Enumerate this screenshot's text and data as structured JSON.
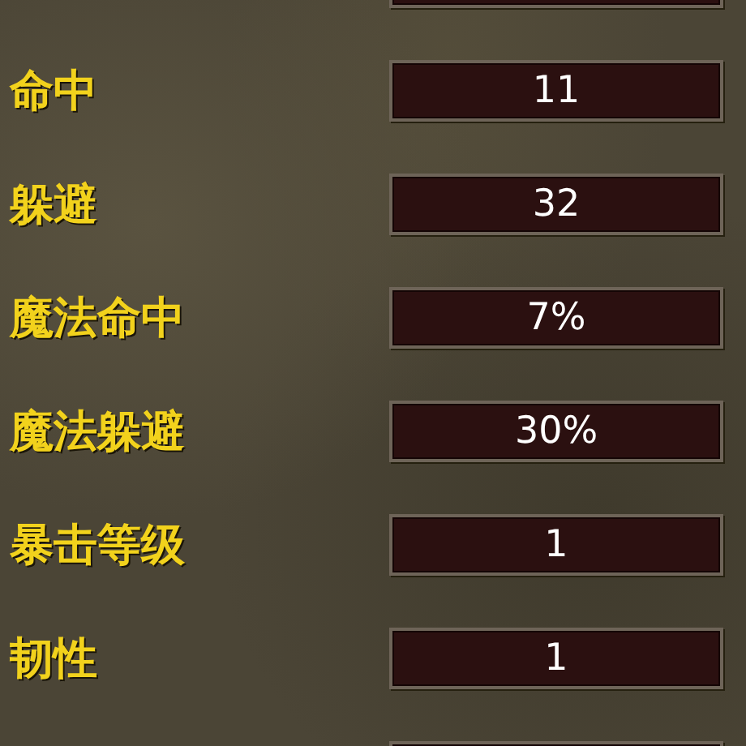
{
  "stats": [
    {
      "label": "命中",
      "value": "11"
    },
    {
      "label": "躲避",
      "value": "32"
    },
    {
      "label": "魔法命中",
      "value": "7%"
    },
    {
      "label": "魔法躲避",
      "value": "30%"
    },
    {
      "label": "暴击等级",
      "value": "1"
    },
    {
      "label": "韧性",
      "value": "1"
    }
  ]
}
